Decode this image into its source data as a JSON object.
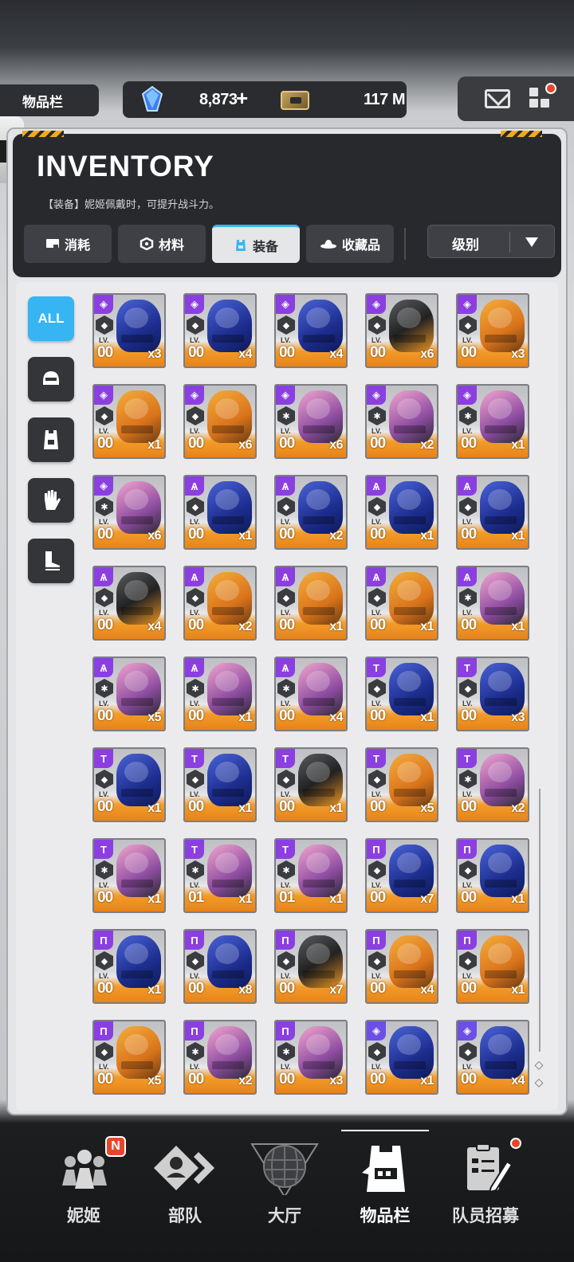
{
  "top_bar": {
    "page_tag": "物品栏",
    "gems": "8,873",
    "gems_add": "+",
    "credits": "117 M"
  },
  "panel": {
    "title": "INVENTORY",
    "description": "【装备】妮姬佩戴时，可提升战斗力。",
    "tabs": [
      {
        "label": "消耗",
        "active": false
      },
      {
        "label": "材料",
        "active": false
      },
      {
        "label": "装备",
        "active": true
      },
      {
        "label": "收藏品",
        "active": false
      }
    ],
    "sort": {
      "label": "级别"
    }
  },
  "filters": {
    "all_label": "ALL",
    "items": [
      "head-icon",
      "torso-icon",
      "arm-icon",
      "leg-icon"
    ]
  },
  "items_common": {
    "lv_label": "LV."
  },
  "items": [
    {
      "rarity": "◈",
      "cls": "◆",
      "art": "blue",
      "lv": "00",
      "qty": "x3"
    },
    {
      "rarity": "◈",
      "cls": "◆",
      "art": "blue",
      "lv": "00",
      "qty": "x4"
    },
    {
      "rarity": "◈",
      "cls": "◆",
      "art": "blue",
      "lv": "00",
      "qty": "x4"
    },
    {
      "rarity": "◈",
      "cls": "◆",
      "art": "dark",
      "lv": "00",
      "qty": "x6"
    },
    {
      "rarity": "◈",
      "cls": "◆",
      "art": "orange",
      "lv": "00",
      "qty": "x3"
    },
    {
      "rarity": "◈",
      "cls": "◆",
      "art": "orange",
      "lv": "00",
      "qty": "x1"
    },
    {
      "rarity": "◈",
      "cls": "◆",
      "art": "orange",
      "lv": "00",
      "qty": "x6"
    },
    {
      "rarity": "◈",
      "cls": "✱",
      "art": "pink",
      "lv": "00",
      "qty": "x6"
    },
    {
      "rarity": "◈",
      "cls": "✱",
      "art": "pink",
      "lv": "00",
      "qty": "x2"
    },
    {
      "rarity": "◈",
      "cls": "✱",
      "art": "pink",
      "lv": "00",
      "qty": "x1"
    },
    {
      "rarity": "◈",
      "cls": "✱",
      "art": "pink",
      "lv": "00",
      "qty": "x6"
    },
    {
      "rarity": "Ѧ",
      "cls": "◆",
      "art": "blue",
      "lv": "00",
      "qty": "x1"
    },
    {
      "rarity": "Ѧ",
      "cls": "◆",
      "art": "blue",
      "lv": "00",
      "qty": "x2"
    },
    {
      "rarity": "Ѧ",
      "cls": "◆",
      "art": "blue",
      "lv": "00",
      "qty": "x1"
    },
    {
      "rarity": "Ѧ",
      "cls": "◆",
      "art": "blue",
      "lv": "00",
      "qty": "x1"
    },
    {
      "rarity": "Ѧ",
      "cls": "◆",
      "art": "dark",
      "lv": "00",
      "qty": "x4"
    },
    {
      "rarity": "Ѧ",
      "cls": "◆",
      "art": "orange",
      "lv": "00",
      "qty": "x2"
    },
    {
      "rarity": "Ѧ",
      "cls": "◆",
      "art": "orange",
      "lv": "00",
      "qty": "x1"
    },
    {
      "rarity": "Ѧ",
      "cls": "◆",
      "art": "orange",
      "lv": "00",
      "qty": "x1"
    },
    {
      "rarity": "Ѧ",
      "cls": "✱",
      "art": "pink",
      "lv": "00",
      "qty": "x1"
    },
    {
      "rarity": "Ѧ",
      "cls": "✱",
      "art": "pink",
      "lv": "00",
      "qty": "x5"
    },
    {
      "rarity": "Ѧ",
      "cls": "✱",
      "art": "pink",
      "lv": "00",
      "qty": "x1"
    },
    {
      "rarity": "Ѧ",
      "cls": "✱",
      "art": "pink",
      "lv": "00",
      "qty": "x4"
    },
    {
      "rarity": "T",
      "cls": "◆",
      "art": "blue",
      "lv": "00",
      "qty": "x1"
    },
    {
      "rarity": "T",
      "cls": "◆",
      "art": "blue",
      "lv": "00",
      "qty": "x3"
    },
    {
      "rarity": "T",
      "cls": "◆",
      "art": "blue",
      "lv": "00",
      "qty": "x1"
    },
    {
      "rarity": "T",
      "cls": "◆",
      "art": "blue",
      "lv": "00",
      "qty": "x1"
    },
    {
      "rarity": "T",
      "cls": "◆",
      "art": "dark",
      "lv": "00",
      "qty": "x1"
    },
    {
      "rarity": "T",
      "cls": "◆",
      "art": "orange",
      "lv": "00",
      "qty": "x5"
    },
    {
      "rarity": "T",
      "cls": "✱",
      "art": "pink",
      "lv": "00",
      "qty": "x2"
    },
    {
      "rarity": "T",
      "cls": "✱",
      "art": "pink",
      "lv": "00",
      "qty": "x1"
    },
    {
      "rarity": "T",
      "cls": "✱",
      "art": "pink",
      "lv": "01",
      "qty": "x1"
    },
    {
      "rarity": "T",
      "cls": "✱",
      "art": "pink",
      "lv": "01",
      "qty": "x1"
    },
    {
      "rarity": "Π",
      "cls": "◆",
      "art": "blue",
      "lv": "00",
      "qty": "x7"
    },
    {
      "rarity": "Π",
      "cls": "◆",
      "art": "blue",
      "lv": "00",
      "qty": "x1"
    },
    {
      "rarity": "Π",
      "cls": "◆",
      "art": "blue",
      "lv": "00",
      "qty": "x1"
    },
    {
      "rarity": "Π",
      "cls": "◆",
      "art": "blue",
      "lv": "00",
      "qty": "x8"
    },
    {
      "rarity": "Π",
      "cls": "◆",
      "art": "dark",
      "lv": "00",
      "qty": "x7"
    },
    {
      "rarity": "Π",
      "cls": "◆",
      "art": "orange",
      "lv": "00",
      "qty": "x4"
    },
    {
      "rarity": "Π",
      "cls": "◆",
      "art": "orange",
      "lv": "00",
      "qty": "x1"
    },
    {
      "rarity": "Π",
      "cls": "◆",
      "art": "orange",
      "lv": "00",
      "qty": "x5"
    },
    {
      "rarity": "Π",
      "cls": "✱",
      "art": "pink",
      "lv": "00",
      "qty": "x2"
    },
    {
      "rarity": "Π",
      "cls": "✱",
      "art": "pink",
      "lv": "00",
      "qty": "x3"
    },
    {
      "rarity": "◈",
      "cls": "◆",
      "art": "blue",
      "lv": "00",
      "qty": "x1"
    },
    {
      "rarity": "◈",
      "cls": "◆",
      "art": "blue",
      "lv": "00",
      "qty": "x4"
    }
  ],
  "bottom_nav": [
    {
      "label": "妮姬",
      "badge": "N"
    },
    {
      "label": "部队"
    },
    {
      "label": "大厅"
    },
    {
      "label": "物品栏",
      "active": true
    },
    {
      "label": "队员招募",
      "dot": true
    }
  ]
}
